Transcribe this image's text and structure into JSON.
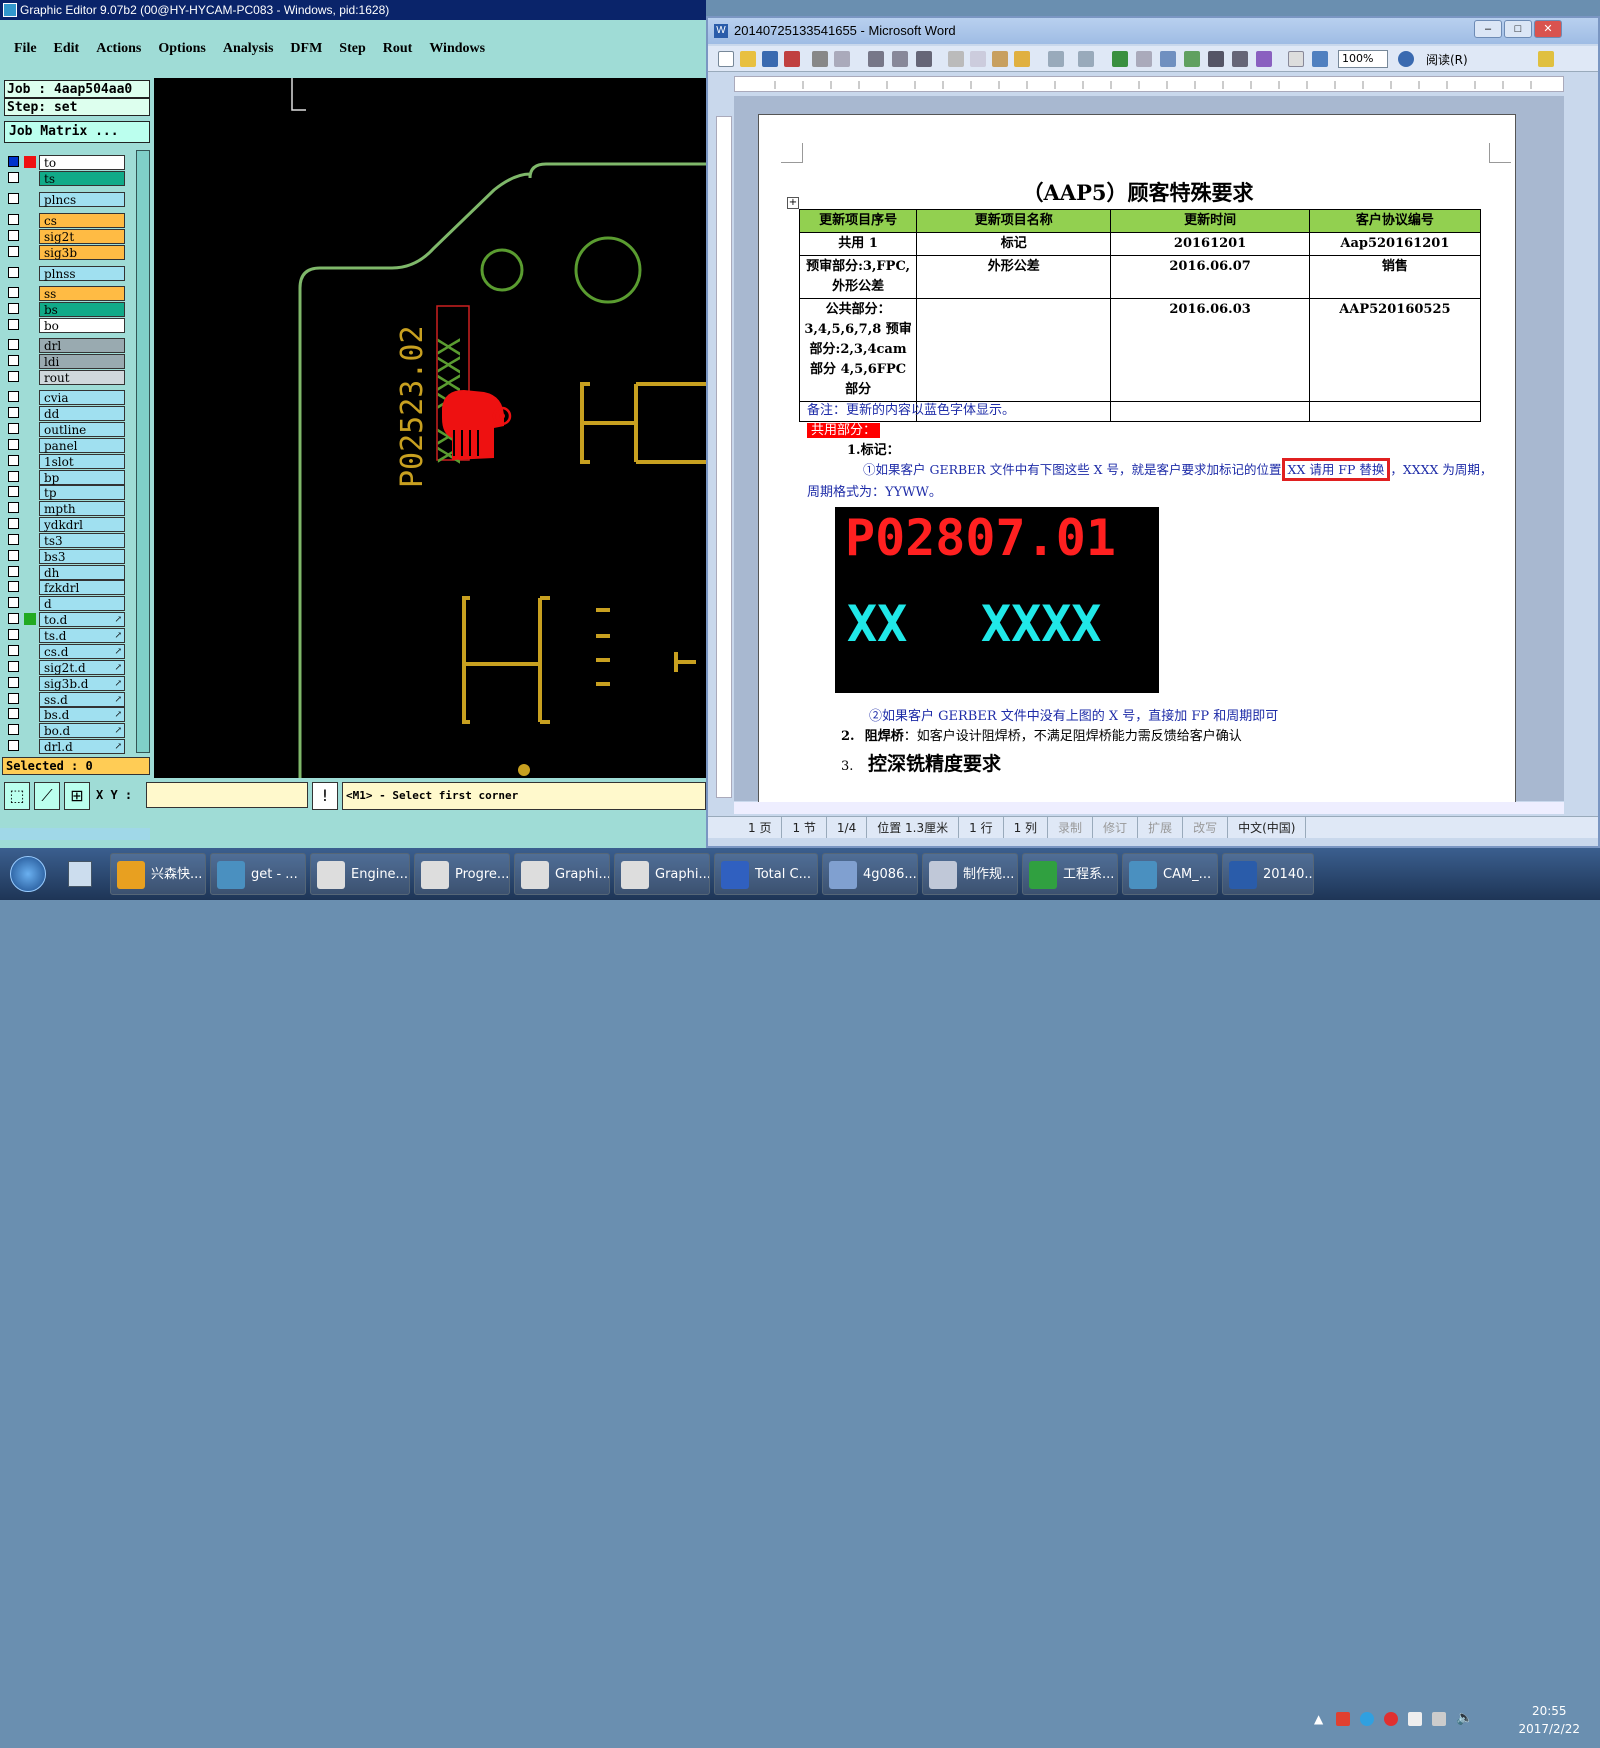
{
  "ge": {
    "title": "Graphic Editor 9.07b2 (00@HY-HYCAM-PC083 - Windows, pid:1628)",
    "menu": [
      "File",
      "Edit",
      "Actions",
      "Options",
      "Analysis",
      "DFM",
      "Step",
      "Rout",
      "Windows"
    ],
    "job": "Job  : 4aap504aa0",
    "step": "Step: set",
    "job_matrix": "Job Matrix ...",
    "layers": [
      {
        "name": "to",
        "color": "#ffffff"
      },
      {
        "name": "ts",
        "color": "#11aa88"
      },
      {
        "name": "plncs",
        "color": "#a0e0f0"
      },
      {
        "name": "cs",
        "color": "#ffbb44"
      },
      {
        "name": "sig2t",
        "color": "#ffbb44"
      },
      {
        "name": "sig3b",
        "color": "#ffbb44"
      },
      {
        "name": "plnss",
        "color": "#a0e0f0"
      },
      {
        "name": "ss",
        "color": "#ffbb44"
      },
      {
        "name": "bs",
        "color": "#11aa88"
      },
      {
        "name": "bo",
        "color": "#ffffff"
      },
      {
        "name": "drl",
        "color": "#99aab0"
      },
      {
        "name": "ldi",
        "color": "#99aab0"
      },
      {
        "name": "rout",
        "color": "#d0d8dc"
      },
      {
        "name": "cvia",
        "color": "#a0e0f0"
      },
      {
        "name": "dd",
        "color": "#a0e0f0"
      },
      {
        "name": "outline",
        "color": "#a0e0f0"
      },
      {
        "name": "panel",
        "color": "#a0e0f0"
      },
      {
        "name": "1slot",
        "color": "#a0e0f0"
      },
      {
        "name": "bp",
        "color": "#a0e0f0"
      },
      {
        "name": "tp",
        "color": "#a0e0f0"
      },
      {
        "name": "mpth",
        "color": "#a0e0f0"
      },
      {
        "name": "ydkdrl",
        "color": "#a0e0f0"
      },
      {
        "name": "ts3",
        "color": "#a0e0f0"
      },
      {
        "name": "bs3",
        "color": "#a0e0f0"
      },
      {
        "name": "dh",
        "color": "#a0e0f0"
      },
      {
        "name": "fzkdrl",
        "color": "#a0e0f0"
      },
      {
        "name": "d",
        "color": "#a0e0f0"
      },
      {
        "name": "to.d",
        "color": "#a0e0f0"
      },
      {
        "name": "ts.d",
        "color": "#a0e0f0"
      },
      {
        "name": "cs.d",
        "color": "#a0e0f0"
      },
      {
        "name": "sig2t.d",
        "color": "#a0e0f0"
      },
      {
        "name": "sig3b.d",
        "color": "#a0e0f0"
      },
      {
        "name": "ss.d",
        "color": "#a0e0f0"
      },
      {
        "name": "bs.d",
        "color": "#a0e0f0"
      },
      {
        "name": "bo.d",
        "color": "#a0e0f0"
      },
      {
        "name": "drl.d",
        "color": "#a0e0f0"
      }
    ],
    "selected": "Selected : 0",
    "xy_label": "X Y :",
    "message": "<M1> - Select first corner",
    "canvas_text": {
      "part": "P02523.02",
      "xxxx": "XXXX",
      "xx": "XX"
    }
  },
  "word": {
    "title": "20140725133541655 - Microsoft Word",
    "zoom": "100%",
    "read_btn": "阅读(R)",
    "doc_title": "（AAP5）顾客特殊要求",
    "table": {
      "headers": [
        "更新项目序号",
        "更新项目名称",
        "更新时间",
        "客户协议编号"
      ],
      "rows": [
        [
          "共用 1",
          "标记",
          "20161201",
          "Aap520161201"
        ],
        [
          "预审部分:3,FPC, 外形公差",
          "外形公差",
          "2016.06.07",
          "销售"
        ],
        [
          "公共部分：3,4,5,6,7,8 预审部分:2,3,4cam 部分 4,5,6FPC 部分",
          "",
          "2016.06.03",
          "AAP520160525"
        ],
        [
          "",
          "",
          "",
          ""
        ]
      ]
    },
    "note": "备注：更新的内容以蓝色字体显示。",
    "shared": "共用部分：",
    "item1": "1.标记：",
    "para1a": "①如果客户 GERBER 文件中有下图这些 X 号，就是客户要求加标记的位置",
    "para1_box": "XX 请用 FP 替换",
    "para1b": "，XXXX 为周期，",
    "para1c": "周期格式为：YYWW。",
    "img_top": "P02807.01",
    "img_xx": "XX",
    "img_xxxx": "XXXX",
    "para2": "②如果客户 GERBER 文件中没有上图的 X 号，直接加 FP 和周期即可",
    "item2_num": "2.",
    "item2_label": "阻焊桥",
    "item2_text": "：如客户设计阻焊桥，不满足阻焊桥能力需反馈给客户确认",
    "item3_num": "3.",
    "item3_text": "控深铣精度要求",
    "status": [
      "1 页",
      "1 节",
      "1/4",
      "位置 1.3厘米",
      "1 行",
      "1 列",
      "录制",
      "修订",
      "扩展",
      "改写",
      "中文(中国)"
    ]
  },
  "taskbar": {
    "tasks": [
      {
        "label": "兴森快...",
        "color": "#e8a020"
      },
      {
        "label": "get - ...",
        "color": "#4a90c0"
      },
      {
        "label": "Engine...",
        "color": "#dddddd"
      },
      {
        "label": "Progre...",
        "color": "#dddddd"
      },
      {
        "label": "Graphi...",
        "color": "#dddddd"
      },
      {
        "label": "Graphi...",
        "color": "#dddddd"
      },
      {
        "label": "Total C...",
        "color": "#3060c0"
      },
      {
        "label": "4g086...",
        "color": "#80a0d0"
      },
      {
        "label": "制作规...",
        "color": "#c0c8d8"
      },
      {
        "label": "工程系...",
        "color": "#30a040"
      },
      {
        "label": "CAM_...",
        "color": "#4a90c0"
      },
      {
        "label": "20140...",
        "color": "#2a5caa"
      }
    ],
    "time": "20:55",
    "date": "2017/2/22"
  }
}
